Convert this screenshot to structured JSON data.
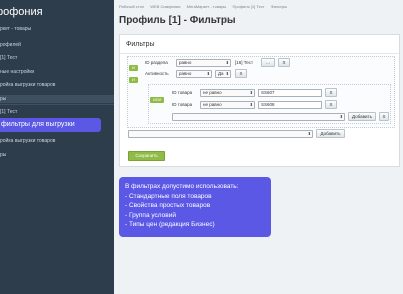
{
  "sidebar": {
    "title": "рофония",
    "items": [
      {
        "label": "ркет - товары"
      },
      {
        "label": "рофилей"
      },
      {
        "label": "[1] Тест"
      },
      {
        "label": "ные настройки"
      },
      {
        "label": "ройка выгрузки товаров"
      },
      {
        "label": "ры"
      },
      {
        "label": "[1] Тест"
      },
      {
        "label": "ройка выгрузки товаров"
      },
      {
        "label": "ры"
      }
    ]
  },
  "breadcrumb": [
    "Рабочий стол",
    "WEB Симфония",
    "МегаМаркет - товары",
    "Профиль [1] Тест",
    "Фильтры"
  ],
  "page": {
    "title": "Профиль [1] - Фильтры"
  },
  "panel": {
    "title": "Фильтры",
    "and_label": "И",
    "or_label": "ИЛИ",
    "row_section": {
      "label": "ID раздела",
      "op": "равно",
      "value": "[16] Тест",
      "dots": "...",
      "remove": "X"
    },
    "row_active": {
      "label": "Активность",
      "op": "равно",
      "value": "Да",
      "remove": "X"
    },
    "row_id1": {
      "label": "ID товара",
      "op": "не равно",
      "value": "SS607",
      "remove": "X"
    },
    "row_id2": {
      "label": "ID товара",
      "op": "не равно",
      "value": "SS608",
      "remove": "X"
    },
    "inner_add": "Добавить",
    "inner_remove": "X",
    "outer_add": "Добавить",
    "save": "Сохранить"
  },
  "callouts": {
    "one": "те фильтры для выгрузки",
    "two": [
      "В фильтрах допустимо использовать:",
      "- Стандартные поля товаров",
      "- Свойства простых товаров",
      "- Группа условий",
      "- Типы цен (редакция Бизнес)"
    ]
  },
  "colors": {
    "sidebar": "#2e3d4c",
    "callout": "#5b58e6",
    "green": "#8fbb46"
  }
}
